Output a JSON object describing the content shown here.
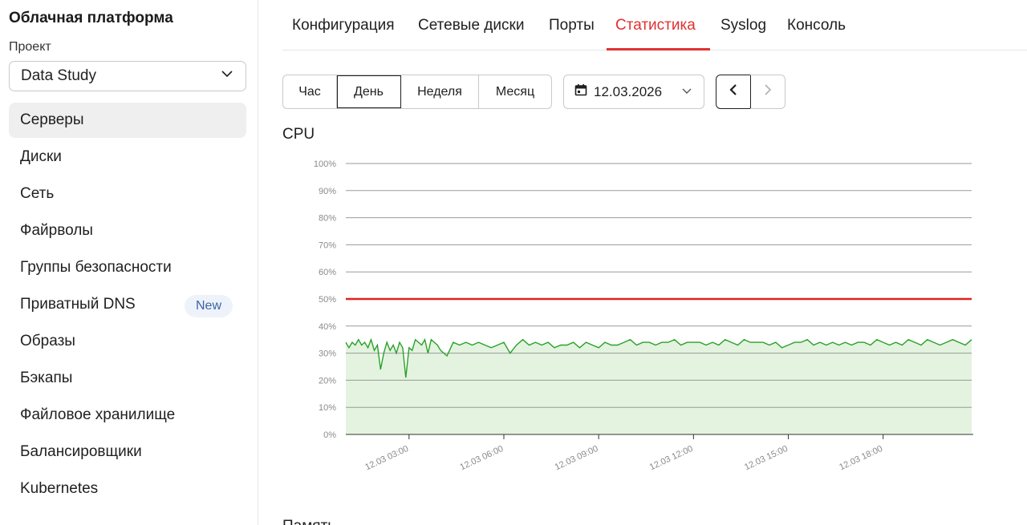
{
  "sidebar": {
    "brand": "Облачная платформа",
    "project_label": "Проект",
    "project_value": "Data Study",
    "items": [
      {
        "label": "Серверы",
        "active": true
      },
      {
        "label": "Диски"
      },
      {
        "label": "Сеть"
      },
      {
        "label": "Файрволы"
      },
      {
        "label": "Группы безопасности"
      },
      {
        "label": "Приватный DNS",
        "badge": "New"
      },
      {
        "label": "Образы"
      },
      {
        "label": "Бэкапы"
      },
      {
        "label": "Файловое хранилище"
      },
      {
        "label": "Балансировщики"
      },
      {
        "label": "Kubernetes"
      }
    ]
  },
  "tabs": [
    {
      "label": "Конфигурация"
    },
    {
      "label": "Сетевые диски"
    },
    {
      "label": "Порты"
    },
    {
      "label": "Статистика",
      "active": true
    },
    {
      "label": "Syslog"
    },
    {
      "label": "Консоль"
    }
  ],
  "range": {
    "options": [
      "Час",
      "День",
      "Неделя",
      "Месяц"
    ],
    "selected": "День"
  },
  "date": "12.03.2026",
  "chart_title": "CPU",
  "next_section_title": "Память",
  "colors": {
    "accent": "#e03131",
    "series": "#2aa12a",
    "fill": "#e3f3df",
    "threshold": "#e02020",
    "grid": "#9a9a9a"
  },
  "chart_data": {
    "type": "area",
    "title": "CPU",
    "y_ticks": [
      "0%",
      "10%",
      "20%",
      "30%",
      "40%",
      "50%",
      "60%",
      "70%",
      "80%",
      "90%",
      "100%"
    ],
    "ylim": [
      0,
      100
    ],
    "x_tick_labels": [
      "12.03 03:00",
      "12.03 06:00",
      "12.03 09:00",
      "12.03 12:00",
      "12.03 15:00",
      "12.03 18:00"
    ],
    "x_ticks_hours": [
      3,
      6,
      9,
      12,
      15,
      18
    ],
    "xlim_hours": [
      1,
      20.8
    ],
    "threshold": 50,
    "series": [
      {
        "x_hours": [
          1.0,
          1.1,
          1.2,
          1.3,
          1.4,
          1.5,
          1.6,
          1.7,
          1.8,
          1.9,
          2.0,
          2.1,
          2.2,
          2.3,
          2.4,
          2.5,
          2.6,
          2.7,
          2.8,
          2.9,
          3.0,
          3.1,
          3.2,
          3.3,
          3.4,
          3.5,
          3.6,
          3.7,
          3.8,
          3.9,
          4.0,
          4.2,
          4.4,
          4.6,
          4.8,
          5.0,
          5.2,
          5.4,
          5.6,
          5.8,
          6.0,
          6.2,
          6.4,
          6.6,
          6.8,
          7.0,
          7.2,
          7.4,
          7.6,
          7.8,
          8.0,
          8.2,
          8.4,
          8.6,
          8.8,
          9.0,
          9.2,
          9.4,
          9.6,
          9.8,
          10.0,
          10.2,
          10.4,
          10.6,
          10.8,
          11.0,
          11.2,
          11.4,
          11.6,
          11.8,
          12.0,
          12.2,
          12.4,
          12.6,
          12.8,
          13.0,
          13.2,
          13.4,
          13.6,
          13.8,
          14.0,
          14.2,
          14.4,
          14.6,
          14.8,
          15.0,
          15.2,
          15.4,
          15.6,
          15.8,
          16.0,
          16.2,
          16.4,
          16.6,
          16.8,
          17.0,
          17.2,
          17.4,
          17.6,
          17.8,
          18.0,
          18.2,
          18.4,
          18.6,
          18.8,
          19.0,
          19.2,
          19.4,
          19.6,
          19.8,
          20.0,
          20.2,
          20.4,
          20.6,
          20.8
        ],
        "values": [
          34,
          32,
          34,
          33,
          35,
          33,
          34,
          32,
          35,
          31,
          33,
          24,
          30,
          34,
          31,
          33,
          30,
          34,
          32,
          21,
          32,
          31,
          35,
          34,
          33,
          35,
          30,
          35,
          34,
          33,
          31,
          29,
          34,
          33,
          34,
          33,
          34,
          33,
          32,
          33,
          34,
          30,
          33,
          35,
          33,
          34,
          33,
          34,
          32,
          33,
          33,
          34,
          32,
          34,
          33,
          32,
          34,
          33,
          33,
          34,
          35,
          33,
          34,
          34,
          33,
          34,
          34,
          35,
          33,
          34,
          34,
          34,
          33,
          34,
          33,
          35,
          34,
          33,
          35,
          34,
          34,
          34,
          33,
          34,
          32,
          33,
          34,
          34,
          35,
          33,
          34,
          33,
          34,
          33,
          34,
          33,
          34,
          34,
          33,
          35,
          34,
          33,
          34,
          33,
          35,
          34,
          33,
          35,
          34,
          33,
          34,
          35,
          34,
          33,
          35
        ]
      }
    ]
  }
}
